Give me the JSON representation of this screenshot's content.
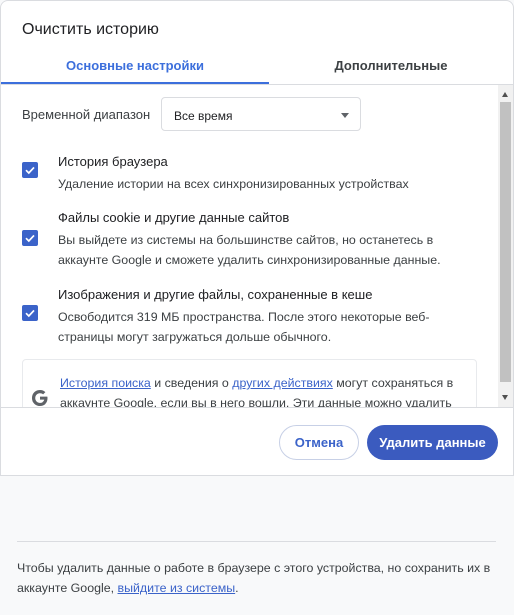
{
  "dialog": {
    "title": "Очистить историю",
    "tabs": [
      {
        "label": "Основные настройки",
        "active": true
      },
      {
        "label": "Дополнительные",
        "active": false
      }
    ],
    "time_range": {
      "label": "Временной диапазон",
      "selected": "Все время"
    },
    "options": [
      {
        "title": "История браузера",
        "description": "Удаление истории на всех синхронизированных устройствах",
        "checked": true
      },
      {
        "title": "Файлы cookie и другие данные сайтов",
        "description": "Вы выйдете из системы на большинстве сайтов, но останетесь в аккаунте Google и сможете удалить синхронизированные данные.",
        "checked": true
      },
      {
        "title": "Изображения и другие файлы, сохраненные в кеше",
        "description": "Освободится 319 МБ пространства. После этого некоторые веб-страницы могут загружаться дольше обычного.",
        "checked": true
      }
    ],
    "info": {
      "link1": "История поиска",
      "text1": " и сведения о ",
      "link2": "других действиях",
      "text2": " могут сохраняться в аккаунте Google, если вы в него вошли. Эти данные можно удалить"
    },
    "buttons": {
      "cancel": "Отмена",
      "delete": "Удалить данные"
    }
  },
  "footer": {
    "text": "Чтобы удалить данные о работе в браузере с этого устройства, но сохранить их в аккаунте Google, ",
    "link": "выйдите из системы",
    "end": "."
  },
  "colors": {
    "accent": "#3b63c9",
    "primary_button": "#3b5bbf"
  }
}
